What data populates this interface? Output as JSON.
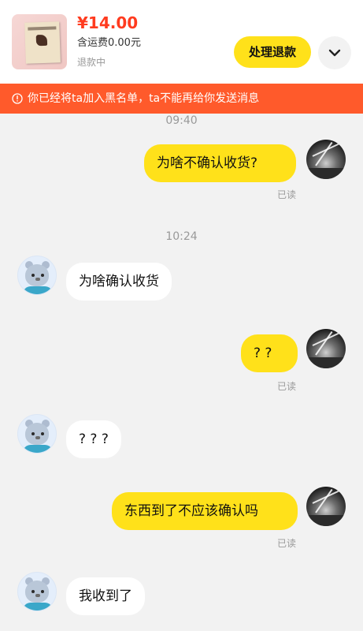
{
  "order": {
    "price": "¥14.00",
    "shipping": "含运费0.00元",
    "status": "退款中",
    "handle_button": "处理退款"
  },
  "block_notice": {
    "text": "你已经将ta加入黑名单，ta不能再给你发送消息",
    "icon": "warning-circle-icon"
  },
  "colors": {
    "accent_yellow": "#ffe11a",
    "price_red": "#ff3b1f",
    "warning_orange": "#ff5a2b"
  },
  "messages": [
    {
      "time": "09:40"
    },
    {
      "from": "me",
      "text": "为啥不确认收货?",
      "status": "已读"
    },
    {
      "time": "10:24"
    },
    {
      "from": "them",
      "text": "为啥确认收货"
    },
    {
      "from": "me",
      "text": "? ?",
      "status": "已读"
    },
    {
      "from": "them",
      "text": "? ? ?"
    },
    {
      "from": "me",
      "text": "东西到了不应该确认吗",
      "status": "已读"
    },
    {
      "from": "them",
      "text": "我收到了"
    }
  ]
}
